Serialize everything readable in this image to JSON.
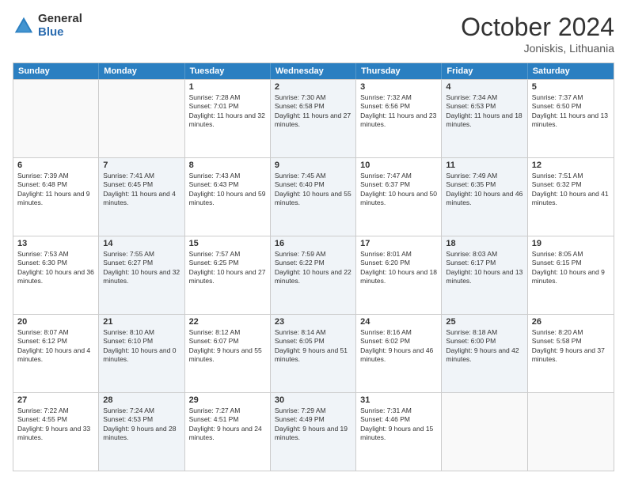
{
  "logo": {
    "general": "General",
    "blue": "Blue"
  },
  "title": {
    "month": "October 2024",
    "location": "Joniskis, Lithuania"
  },
  "headers": [
    "Sunday",
    "Monday",
    "Tuesday",
    "Wednesday",
    "Thursday",
    "Friday",
    "Saturday"
  ],
  "weeks": [
    [
      {
        "day": "",
        "sunrise": "",
        "sunset": "",
        "daylight": "",
        "shaded": false,
        "empty": true
      },
      {
        "day": "",
        "sunrise": "",
        "sunset": "",
        "daylight": "",
        "shaded": false,
        "empty": true
      },
      {
        "day": "1",
        "sunrise": "Sunrise: 7:28 AM",
        "sunset": "Sunset: 7:01 PM",
        "daylight": "Daylight: 11 hours and 32 minutes.",
        "shaded": false,
        "empty": false
      },
      {
        "day": "2",
        "sunrise": "Sunrise: 7:30 AM",
        "sunset": "Sunset: 6:58 PM",
        "daylight": "Daylight: 11 hours and 27 minutes.",
        "shaded": true,
        "empty": false
      },
      {
        "day": "3",
        "sunrise": "Sunrise: 7:32 AM",
        "sunset": "Sunset: 6:56 PM",
        "daylight": "Daylight: 11 hours and 23 minutes.",
        "shaded": false,
        "empty": false
      },
      {
        "day": "4",
        "sunrise": "Sunrise: 7:34 AM",
        "sunset": "Sunset: 6:53 PM",
        "daylight": "Daylight: 11 hours and 18 minutes.",
        "shaded": true,
        "empty": false
      },
      {
        "day": "5",
        "sunrise": "Sunrise: 7:37 AM",
        "sunset": "Sunset: 6:50 PM",
        "daylight": "Daylight: 11 hours and 13 minutes.",
        "shaded": false,
        "empty": false
      }
    ],
    [
      {
        "day": "6",
        "sunrise": "Sunrise: 7:39 AM",
        "sunset": "Sunset: 6:48 PM",
        "daylight": "Daylight: 11 hours and 9 minutes.",
        "shaded": false,
        "empty": false
      },
      {
        "day": "7",
        "sunrise": "Sunrise: 7:41 AM",
        "sunset": "Sunset: 6:45 PM",
        "daylight": "Daylight: 11 hours and 4 minutes.",
        "shaded": true,
        "empty": false
      },
      {
        "day": "8",
        "sunrise": "Sunrise: 7:43 AM",
        "sunset": "Sunset: 6:43 PM",
        "daylight": "Daylight: 10 hours and 59 minutes.",
        "shaded": false,
        "empty": false
      },
      {
        "day": "9",
        "sunrise": "Sunrise: 7:45 AM",
        "sunset": "Sunset: 6:40 PM",
        "daylight": "Daylight: 10 hours and 55 minutes.",
        "shaded": true,
        "empty": false
      },
      {
        "day": "10",
        "sunrise": "Sunrise: 7:47 AM",
        "sunset": "Sunset: 6:37 PM",
        "daylight": "Daylight: 10 hours and 50 minutes.",
        "shaded": false,
        "empty": false
      },
      {
        "day": "11",
        "sunrise": "Sunrise: 7:49 AM",
        "sunset": "Sunset: 6:35 PM",
        "daylight": "Daylight: 10 hours and 46 minutes.",
        "shaded": true,
        "empty": false
      },
      {
        "day": "12",
        "sunrise": "Sunrise: 7:51 AM",
        "sunset": "Sunset: 6:32 PM",
        "daylight": "Daylight: 10 hours and 41 minutes.",
        "shaded": false,
        "empty": false
      }
    ],
    [
      {
        "day": "13",
        "sunrise": "Sunrise: 7:53 AM",
        "sunset": "Sunset: 6:30 PM",
        "daylight": "Daylight: 10 hours and 36 minutes.",
        "shaded": false,
        "empty": false
      },
      {
        "day": "14",
        "sunrise": "Sunrise: 7:55 AM",
        "sunset": "Sunset: 6:27 PM",
        "daylight": "Daylight: 10 hours and 32 minutes.",
        "shaded": true,
        "empty": false
      },
      {
        "day": "15",
        "sunrise": "Sunrise: 7:57 AM",
        "sunset": "Sunset: 6:25 PM",
        "daylight": "Daylight: 10 hours and 27 minutes.",
        "shaded": false,
        "empty": false
      },
      {
        "day": "16",
        "sunrise": "Sunrise: 7:59 AM",
        "sunset": "Sunset: 6:22 PM",
        "daylight": "Daylight: 10 hours and 22 minutes.",
        "shaded": true,
        "empty": false
      },
      {
        "day": "17",
        "sunrise": "Sunrise: 8:01 AM",
        "sunset": "Sunset: 6:20 PM",
        "daylight": "Daylight: 10 hours and 18 minutes.",
        "shaded": false,
        "empty": false
      },
      {
        "day": "18",
        "sunrise": "Sunrise: 8:03 AM",
        "sunset": "Sunset: 6:17 PM",
        "daylight": "Daylight: 10 hours and 13 minutes.",
        "shaded": true,
        "empty": false
      },
      {
        "day": "19",
        "sunrise": "Sunrise: 8:05 AM",
        "sunset": "Sunset: 6:15 PM",
        "daylight": "Daylight: 10 hours and 9 minutes.",
        "shaded": false,
        "empty": false
      }
    ],
    [
      {
        "day": "20",
        "sunrise": "Sunrise: 8:07 AM",
        "sunset": "Sunset: 6:12 PM",
        "daylight": "Daylight: 10 hours and 4 minutes.",
        "shaded": false,
        "empty": false
      },
      {
        "day": "21",
        "sunrise": "Sunrise: 8:10 AM",
        "sunset": "Sunset: 6:10 PM",
        "daylight": "Daylight: 10 hours and 0 minutes.",
        "shaded": true,
        "empty": false
      },
      {
        "day": "22",
        "sunrise": "Sunrise: 8:12 AM",
        "sunset": "Sunset: 6:07 PM",
        "daylight": "Daylight: 9 hours and 55 minutes.",
        "shaded": false,
        "empty": false
      },
      {
        "day": "23",
        "sunrise": "Sunrise: 8:14 AM",
        "sunset": "Sunset: 6:05 PM",
        "daylight": "Daylight: 9 hours and 51 minutes.",
        "shaded": true,
        "empty": false
      },
      {
        "day": "24",
        "sunrise": "Sunrise: 8:16 AM",
        "sunset": "Sunset: 6:02 PM",
        "daylight": "Daylight: 9 hours and 46 minutes.",
        "shaded": false,
        "empty": false
      },
      {
        "day": "25",
        "sunrise": "Sunrise: 8:18 AM",
        "sunset": "Sunset: 6:00 PM",
        "daylight": "Daylight: 9 hours and 42 minutes.",
        "shaded": true,
        "empty": false
      },
      {
        "day": "26",
        "sunrise": "Sunrise: 8:20 AM",
        "sunset": "Sunset: 5:58 PM",
        "daylight": "Daylight: 9 hours and 37 minutes.",
        "shaded": false,
        "empty": false
      }
    ],
    [
      {
        "day": "27",
        "sunrise": "Sunrise: 7:22 AM",
        "sunset": "Sunset: 4:55 PM",
        "daylight": "Daylight: 9 hours and 33 minutes.",
        "shaded": false,
        "empty": false
      },
      {
        "day": "28",
        "sunrise": "Sunrise: 7:24 AM",
        "sunset": "Sunset: 4:53 PM",
        "daylight": "Daylight: 9 hours and 28 minutes.",
        "shaded": true,
        "empty": false
      },
      {
        "day": "29",
        "sunrise": "Sunrise: 7:27 AM",
        "sunset": "Sunset: 4:51 PM",
        "daylight": "Daylight: 9 hours and 24 minutes.",
        "shaded": false,
        "empty": false
      },
      {
        "day": "30",
        "sunrise": "Sunrise: 7:29 AM",
        "sunset": "Sunset: 4:49 PM",
        "daylight": "Daylight: 9 hours and 19 minutes.",
        "shaded": true,
        "empty": false
      },
      {
        "day": "31",
        "sunrise": "Sunrise: 7:31 AM",
        "sunset": "Sunset: 4:46 PM",
        "daylight": "Daylight: 9 hours and 15 minutes.",
        "shaded": false,
        "empty": false
      },
      {
        "day": "",
        "sunrise": "",
        "sunset": "",
        "daylight": "",
        "shaded": false,
        "empty": true
      },
      {
        "day": "",
        "sunrise": "",
        "sunset": "",
        "daylight": "",
        "shaded": false,
        "empty": true
      }
    ]
  ]
}
